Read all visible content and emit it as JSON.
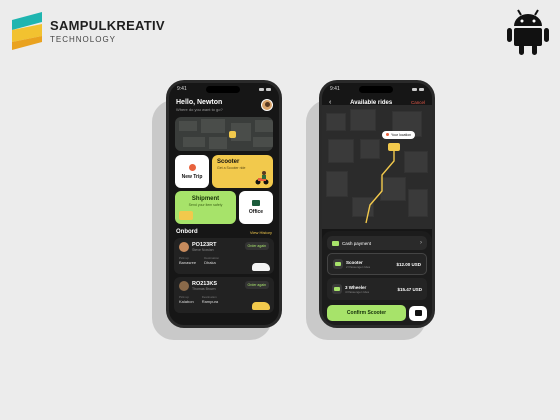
{
  "brand": {
    "name": "SAMPULKREATIV",
    "subtitle": "TECHNOLOGY"
  },
  "platform_icon": "android-icon",
  "phone1": {
    "status_time": "9:41",
    "greeting": "Hello, Newton",
    "greeting_sub": "Where do you want to go?",
    "tiles": {
      "new_trip": "New Trip",
      "scooter_title": "Scooter",
      "scooter_sub": "Get a Scooter ride",
      "shipment_title": "Shipment",
      "shipment_sub": "Send your item safely",
      "office": "Office"
    },
    "onbord": {
      "title": "Onbord",
      "view_history": "View History"
    },
    "orders": [
      {
        "id": "PO123RT",
        "name": "Steve Nowlan",
        "btn": "Order again",
        "from_label": "Pick up",
        "from": "Banasree",
        "to_label": "Destination",
        "to": "Dhaka"
      },
      {
        "id": "RO213KS",
        "name": "Thomas Brown",
        "btn": "Order again",
        "from_label": "Pick up",
        "from": "Kalabon",
        "to_label": "Destination",
        "to": "Rampura"
      }
    ]
  },
  "phone2": {
    "status_time": "9:41",
    "title": "Available rides",
    "back": "‹",
    "cancel": "Cancel",
    "your_location": "Your location",
    "payment": "Cash payment",
    "rides": [
      {
        "name": "Scooter",
        "sub": "2 Passenger rides",
        "price": "$12.00 USD"
      },
      {
        "name": "3 Wheeler",
        "sub": "4 Passenger rides",
        "price": "$15.47 USD"
      }
    ],
    "confirm": "Confirm Scooter"
  },
  "colors": {
    "accent_yellow": "#f2c94c",
    "accent_green": "#a7e36a",
    "phone_bg": "#161616"
  }
}
